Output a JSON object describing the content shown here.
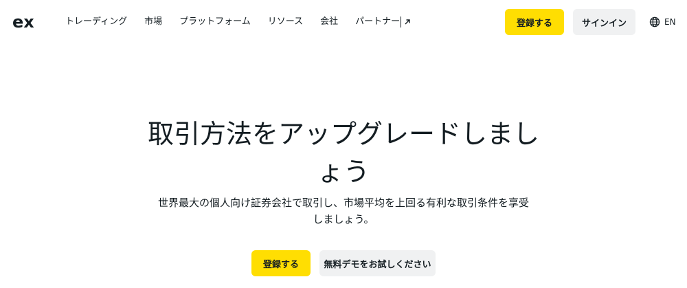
{
  "header": {
    "logo_label": "ex",
    "nav": [
      {
        "label": "トレーディング"
      },
      {
        "label": "市場"
      },
      {
        "label": "プラットフォーム"
      },
      {
        "label": "リソース"
      },
      {
        "label": "会社"
      },
      {
        "label": "パートナー",
        "icon": "external-link-icon"
      }
    ],
    "register_label": "登録する",
    "signin_label": "サインイン",
    "language": "EN",
    "language_icon": "globe-icon"
  },
  "hero": {
    "title": "取引方法をアップグレードしましょう",
    "subtitle": "世界最大の個人向け証券会社で取引し、市場平均を上回る有利な取引条件を享受しましょう。",
    "register_label": "登録する",
    "demo_label": "無料デモをお試しください"
  },
  "colors": {
    "accent": "#ffde02",
    "secondary_button": "#f0f1f2",
    "text": "#141d22",
    "background": "#ffffff"
  }
}
